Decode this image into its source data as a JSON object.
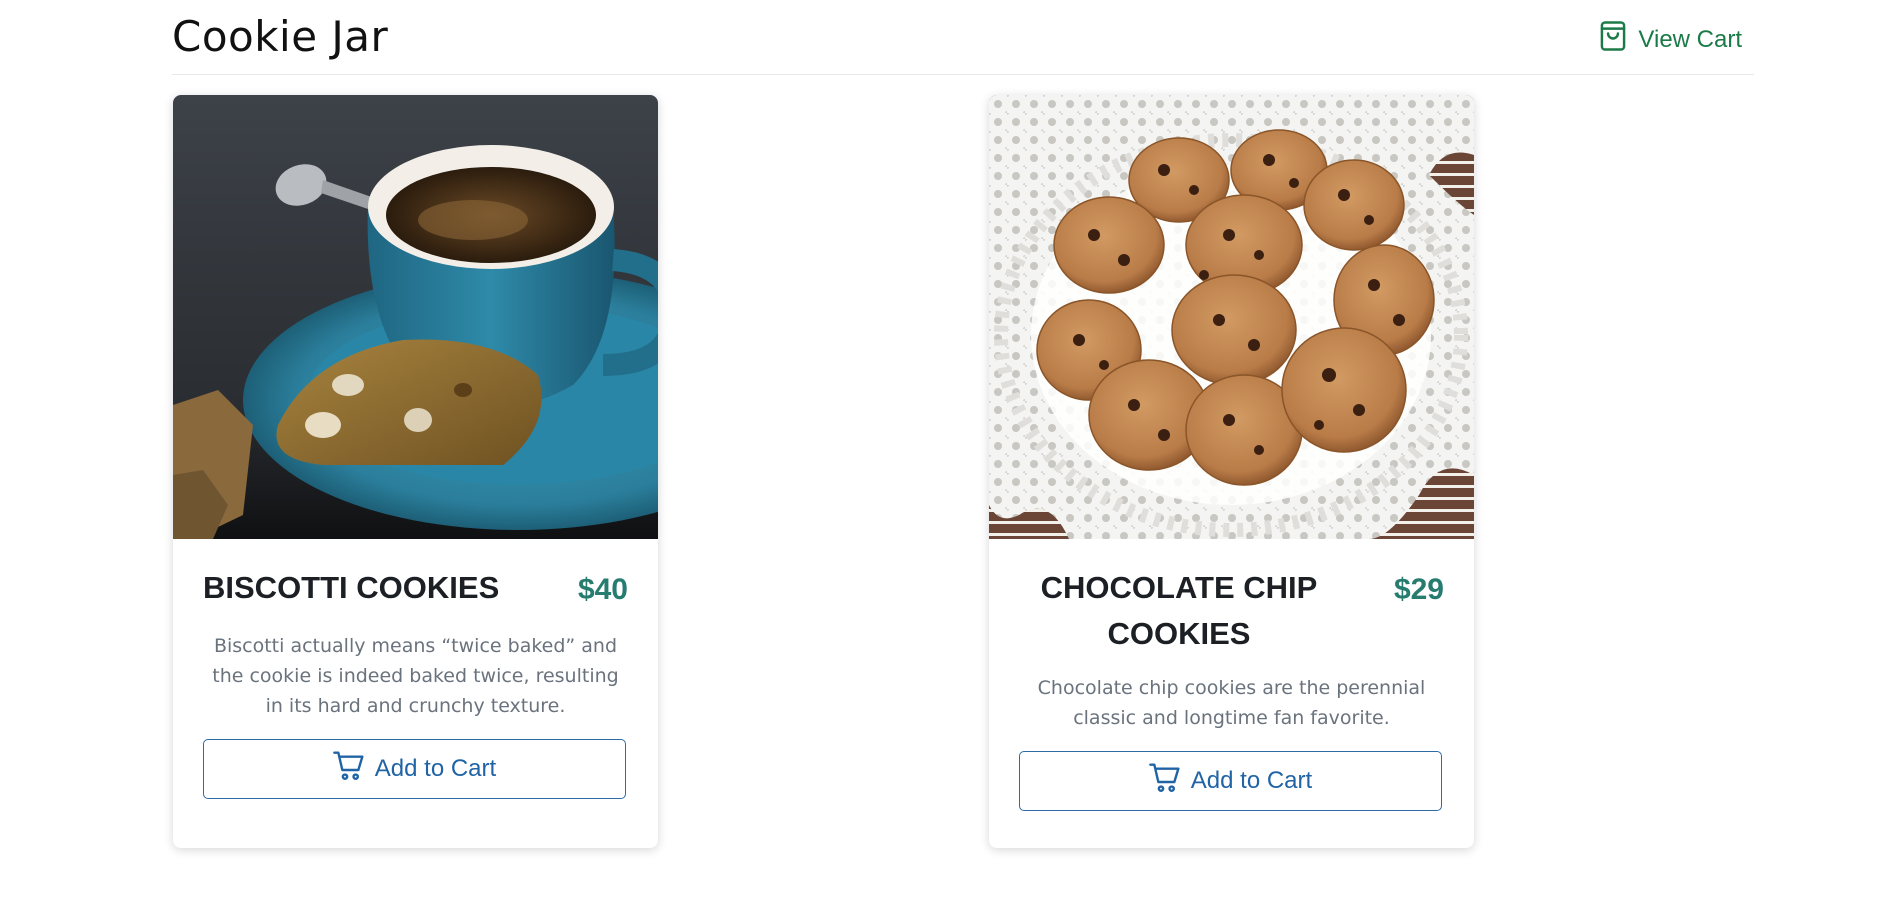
{
  "header": {
    "brand": "Cookie Jar",
    "view_cart_label": "View Cart",
    "view_cart_icon": "shopping-bag-icon",
    "accent_color": "#1b7a48"
  },
  "products": [
    {
      "name": "BISCOTTI COOKIES",
      "price": "$40",
      "description": "Biscotti actually means “twice baked” and the cookie is indeed baked twice, resulting in its hard and crunchy texture.",
      "button_label": "Add to Cart",
      "button_icon": "cart-icon",
      "image_alt": "biscotti with blue coffee cup"
    },
    {
      "name": "CHOCOLATE CHIP COOKIES",
      "price": "$29",
      "description": "Chocolate chip cookies are the perennial classic and longtime fan favorite.",
      "button_label": "Add to Cart",
      "button_icon": "cart-icon",
      "image_alt": "plate of chocolate chip cookies on lace doily"
    }
  ],
  "colors": {
    "price": "#277c70",
    "button": "#2164a6",
    "title": "#1c1f24",
    "description": "#6a737d"
  }
}
